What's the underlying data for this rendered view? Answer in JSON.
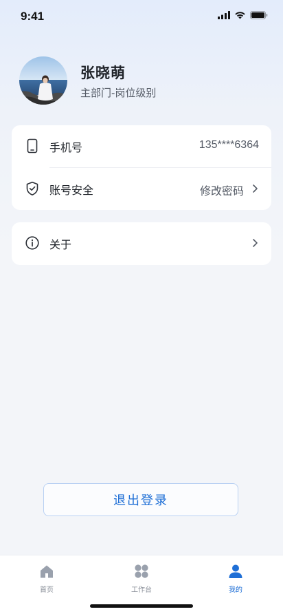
{
  "status_bar": {
    "time": "9:41"
  },
  "profile": {
    "name": "张晓萌",
    "department": "主部门-岗位级别"
  },
  "settings": {
    "phone": {
      "label": "手机号",
      "value": "135****6364",
      "icon": "phone-icon"
    },
    "security": {
      "label": "账号安全",
      "value": "修改密码",
      "icon": "shield-check-icon"
    },
    "about": {
      "label": "关于",
      "icon": "info-icon"
    }
  },
  "logout_label": "退出登录",
  "tabbar": {
    "items": [
      {
        "label": "首页",
        "icon": "home-icon",
        "active": false
      },
      {
        "label": "工作台",
        "icon": "grid-icon",
        "active": false
      },
      {
        "label": "我的",
        "icon": "user-icon",
        "active": true
      }
    ]
  },
  "colors": {
    "accent": "#1f6fd6",
    "background": "#f3f5f9",
    "card": "#ffffff",
    "muted_text": "#555b66"
  }
}
